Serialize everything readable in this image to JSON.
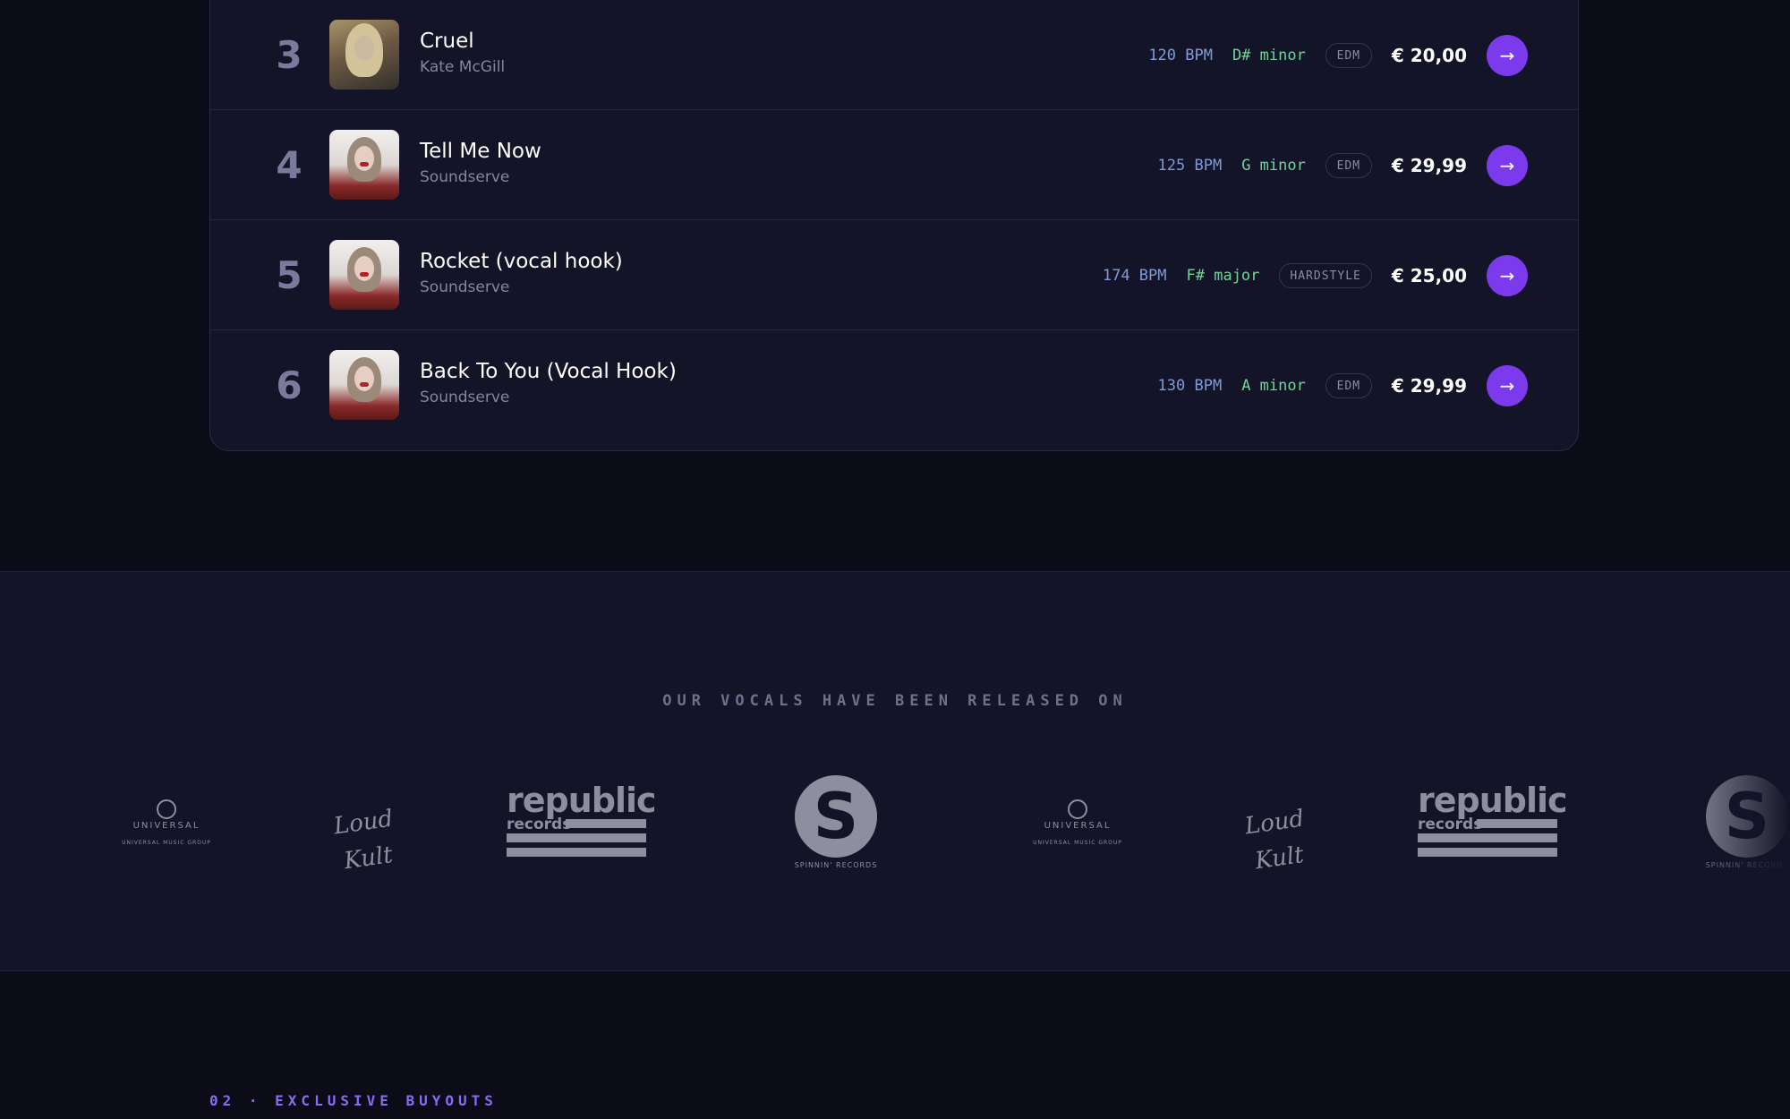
{
  "tracks": [
    {
      "rank": "3",
      "title": "Cruel",
      "artist": "Kate McGill",
      "bpm": "120 BPM",
      "key": "D# minor",
      "genre": "EDM",
      "price": "€ 20,00"
    },
    {
      "rank": "4",
      "title": "Tell Me Now",
      "artist": "Soundserve",
      "bpm": "125 BPM",
      "key": "G minor",
      "genre": "EDM",
      "price": "€ 29,99"
    },
    {
      "rank": "5",
      "title": "Rocket (vocal hook)",
      "artist": "Soundserve",
      "bpm": "174 BPM",
      "key": "F# major",
      "genre": "HARDSTYLE",
      "price": "€ 25,00"
    },
    {
      "rank": "6",
      "title": "Back To You (Vocal Hook)",
      "artist": "Soundserve",
      "bpm": "130 BPM",
      "key": "A minor",
      "genre": "EDM",
      "price": "€ 29,99"
    }
  ],
  "labels_band": {
    "heading": "OUR VOCALS HAVE BEEN RELEASED ON",
    "logos": [
      {
        "name": "Universal Music Group",
        "word": "UNIVERSAL",
        "sub": "UNIVERSAL MUSIC GROUP"
      },
      {
        "name": "Loud Kult",
        "word": "Loud Kult"
      },
      {
        "name": "Republic Records",
        "word": "republic",
        "sub": "records"
      },
      {
        "name": "Spinnin' Records",
        "word": "S",
        "sub": "SPINNIN' RECORDS"
      }
    ]
  },
  "next_section": {
    "label": "02 · EXCLUSIVE BUYOUTS"
  },
  "colors": {
    "accent": "#7c3aed",
    "bpm": "#7f9bd6",
    "key": "#74d39a",
    "label": "#8b6cf0"
  },
  "icons": {
    "go": "arrow-right-icon"
  }
}
